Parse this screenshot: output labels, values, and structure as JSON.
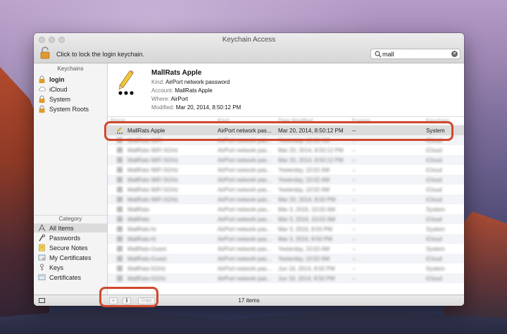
{
  "window": {
    "title": "Keychain Access",
    "lock_text": "Click to lock the login keychain."
  },
  "search": {
    "value": "mall",
    "placeholder": "Search"
  },
  "sidebar": {
    "keychains_header": "Keychains",
    "keychains": [
      {
        "label": "login",
        "icon": "lock-icon"
      },
      {
        "label": "iCloud",
        "icon": "cloud-icon"
      },
      {
        "label": "System",
        "icon": "lock-icon"
      },
      {
        "label": "System Roots",
        "icon": "lock-icon"
      }
    ],
    "category_header": "Category",
    "categories": [
      {
        "label": "All Items",
        "icon": "all-items-icon"
      },
      {
        "label": "Passwords",
        "icon": "key-icon"
      },
      {
        "label": "Secure Notes",
        "icon": "note-icon"
      },
      {
        "label": "My Certificates",
        "icon": "certificate-icon"
      },
      {
        "label": "Keys",
        "icon": "key-icon"
      },
      {
        "label": "Certificates",
        "icon": "certificate-icon"
      }
    ]
  },
  "detail": {
    "title": "MallRats Apple",
    "kind_label": "Kind:",
    "kind": "AirPort network password",
    "account_label": "Account:",
    "account": "MallRats Apple",
    "where_label": "Where:",
    "where": "AirPort",
    "modified_label": "Modified:",
    "modified": "Mar 20, 2014, 8:50:12 PM"
  },
  "list": {
    "columns": [
      "Name",
      "Kind",
      "Date Modified",
      "Expires",
      "Keychain"
    ],
    "selected_row": {
      "name": "MallRats Apple",
      "kind": "AirPort network pas...",
      "date": "Mar 20, 2014, 8:50:12 PM",
      "expires": "--",
      "keychain": "System"
    },
    "blurred_rows": [
      {
        "name": "MallRats WiFi",
        "kind": "AirPort network pas...",
        "date": "Yesterday, 10:02 AM",
        "expires": "--",
        "keychain": "iCloud"
      },
      {
        "name": "MallRats WiFi 5GHz",
        "kind": "AirPort network pas...",
        "date": "Mar 20, 2014, 8:50:12 PM",
        "expires": "--",
        "keychain": "iCloud"
      },
      {
        "name": "MallRats WiFi 5GHz",
        "kind": "AirPort network pas...",
        "date": "Mar 20, 2014, 8:50:12 PM",
        "expires": "--",
        "keychain": "iCloud"
      },
      {
        "name": "MallRats WiFi 5GHz",
        "kind": "AirPort network pas...",
        "date": "Yesterday, 10:02 AM",
        "expires": "--",
        "keychain": "iCloud"
      },
      {
        "name": "MallRats WiFi 5GHz",
        "kind": "AirPort network pas...",
        "date": "Yesterday, 10:02 AM",
        "expires": "--",
        "keychain": "iCloud"
      },
      {
        "name": "MallRats WiFi 5GHz",
        "kind": "AirPort network pas...",
        "date": "Yesterday, 10:02 AM",
        "expires": "--",
        "keychain": "iCloud"
      },
      {
        "name": "MallRats WiFi 5GHz",
        "kind": "AirPort network pas...",
        "date": "Mar 20, 2014, 8:50 PM",
        "expires": "--",
        "keychain": "iCloud"
      },
      {
        "name": "MallRats",
        "kind": "AirPort network pas...",
        "date": "Mar 3, 2016, 10:02 AM",
        "expires": "--",
        "keychain": "System"
      },
      {
        "name": "MallRats",
        "kind": "AirPort network pas...",
        "date": "Mar 3, 2016, 10:02 AM",
        "expires": "--",
        "keychain": "iCloud"
      },
      {
        "name": "MallRats-ht",
        "kind": "AirPort network pas...",
        "date": "Mar 3, 2016, 8:50 PM",
        "expires": "--",
        "keychain": "System"
      },
      {
        "name": "MallRats-ht",
        "kind": "AirPort network pas...",
        "date": "Mar 3, 2016, 8:50 PM",
        "expires": "--",
        "keychain": "iCloud"
      },
      {
        "name": "MallRats-Guest",
        "kind": "AirPort network pas...",
        "date": "Yesterday, 10:02 AM",
        "expires": "--",
        "keychain": "System"
      },
      {
        "name": "MallRats-Guest",
        "kind": "AirPort network pas...",
        "date": "Yesterday, 10:02 AM",
        "expires": "--",
        "keychain": "iCloud"
      },
      {
        "name": "MallRats-5GHz",
        "kind": "AirPort network pas...",
        "date": "Jun 16, 2014, 8:50 PM",
        "expires": "--",
        "keychain": "System"
      },
      {
        "name": "MallRats-5GHz",
        "kind": "AirPort network pas...",
        "date": "Jun 16, 2014, 8:50 PM",
        "expires": "--",
        "keychain": "iCloud"
      }
    ]
  },
  "statusbar": {
    "plus": "+",
    "info": "i",
    "copy": "Copy",
    "count": "17 items"
  },
  "colors": {
    "highlight": "#d0482c",
    "selection": "#dcdcdc"
  }
}
